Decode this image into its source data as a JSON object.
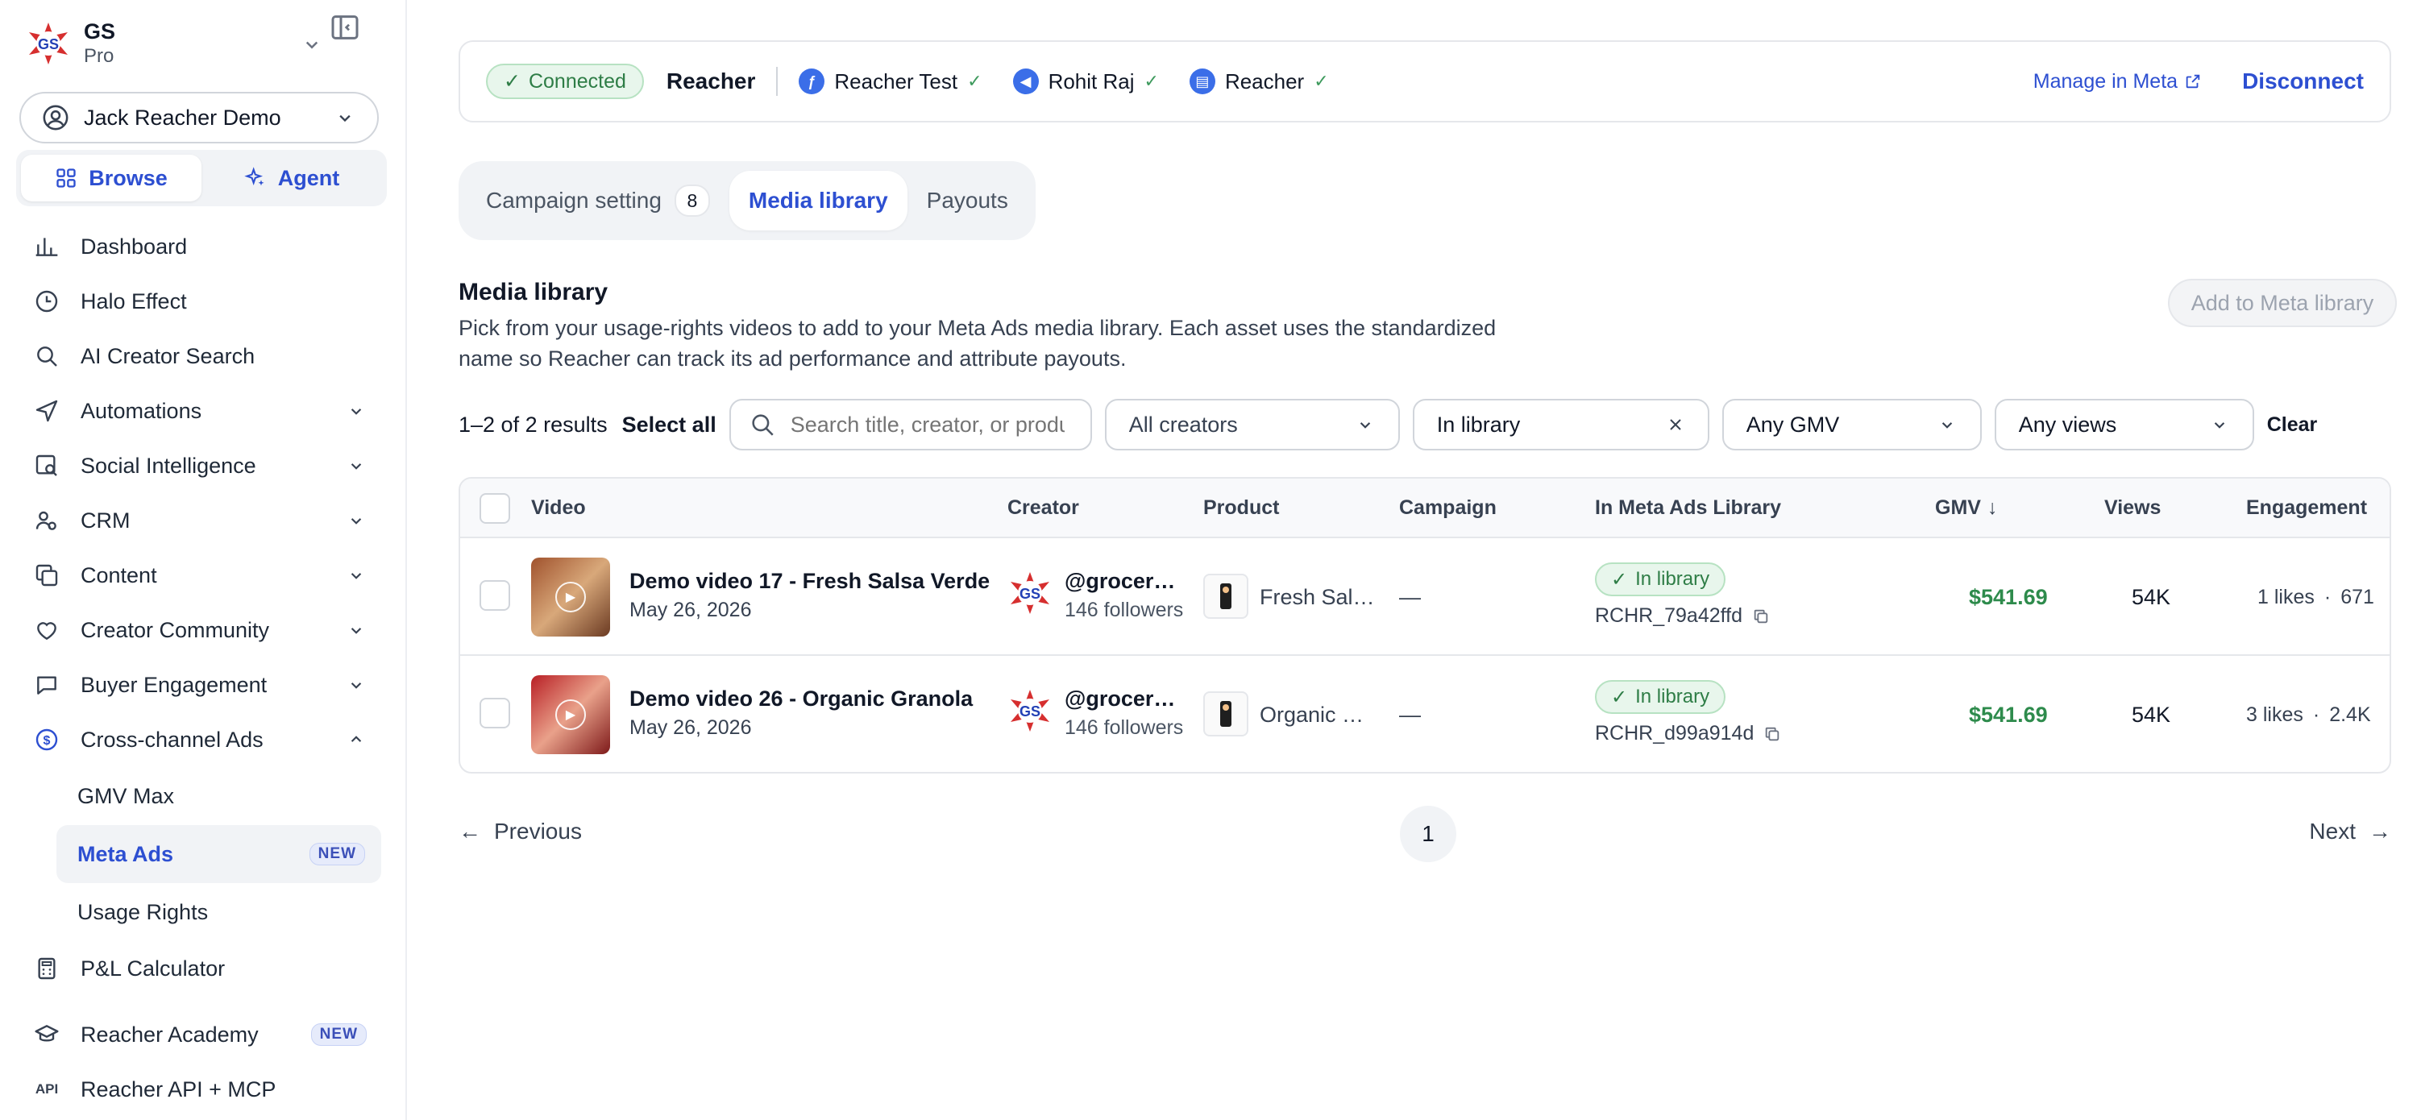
{
  "org": {
    "name": "GS",
    "plan": "Pro",
    "logo_text": "GS"
  },
  "account": {
    "label": "Jack Reacher Demo"
  },
  "mode": {
    "browse": "Browse",
    "agent": "Agent"
  },
  "nav": {
    "items": [
      {
        "label": "Dashboard",
        "icon": "chart-bar-icon"
      },
      {
        "label": "Halo Effect",
        "icon": "clock-icon"
      },
      {
        "label": "AI Creator Search",
        "icon": "search-icon"
      },
      {
        "label": "Automations",
        "icon": "send-icon"
      },
      {
        "label": "Social Intelligence",
        "icon": "image-search-icon"
      },
      {
        "label": "CRM",
        "icon": "people-icon"
      },
      {
        "label": "Content",
        "icon": "copy-icon"
      },
      {
        "label": "Creator Community",
        "icon": "heart-hands-icon"
      },
      {
        "label": "Buyer Engagement",
        "icon": "chat-icon"
      },
      {
        "label": "Cross-channel Ads",
        "icon": "dollar-circle-icon"
      }
    ],
    "sub_items": [
      {
        "label": "GMV Max"
      },
      {
        "label": "Meta Ads",
        "badge": "NEW"
      },
      {
        "label": "Usage Rights"
      }
    ],
    "bottom_items": [
      {
        "label": "P&L Calculator",
        "icon": "calculator-icon"
      },
      {
        "label": "Reacher Academy",
        "icon": "graduation-cap-icon",
        "badge": "NEW"
      },
      {
        "label": "Reacher API + MCP",
        "icon": "api-icon",
        "icon_text": "API"
      }
    ]
  },
  "connection": {
    "status": "Connected",
    "name": "Reacher",
    "accounts": [
      {
        "label": "Reacher Test",
        "icon": "meta-icon"
      },
      {
        "label": "Rohit Raj",
        "icon": "ads-icon"
      },
      {
        "label": "Reacher",
        "icon": "page-icon"
      }
    ],
    "manage_label": "Manage in Meta",
    "disconnect_label": "Disconnect"
  },
  "tabs": [
    {
      "label": "Campaign setting",
      "count": "8"
    },
    {
      "label": "Media library"
    },
    {
      "label": "Payouts"
    }
  ],
  "section": {
    "title": "Media library",
    "description": "Pick from your usage-rights videos to add to your Meta Ads media library. Each asset uses the standardized name so Reacher can track its ad performance and attribute payouts.",
    "add_button": "Add to Meta library"
  },
  "filters": {
    "results": "1–2 of 2 results",
    "select_all": "Select all",
    "search_placeholder": "Search title, creator, or product",
    "creators": "All creators",
    "library": "In library",
    "gmv": "Any GMV",
    "views": "Any views",
    "clear": "Clear"
  },
  "table": {
    "columns": [
      "Video",
      "Creator",
      "Product",
      "Campaign",
      "In Meta Ads Library",
      "GMV",
      "Views",
      "Engagement"
    ],
    "rows": [
      {
        "title": "Demo video 17 - Fresh Salsa Verde",
        "date": "May 26, 2026",
        "creator_handle": "@grocerystore",
        "creator_followers": "146 followers",
        "product": "Fresh Salsa Verde",
        "campaign": "—",
        "library_status": "In library",
        "library_code": "RCHR_79a42ffd",
        "gmv": "$541.69",
        "views": "54K",
        "likes": "1 likes",
        "engagement_sep": "·",
        "engagement_other": "671"
      },
      {
        "title": "Demo video 26 - Organic Granola",
        "date": "May 26, 2026",
        "creator_handle": "@grocerystore",
        "creator_followers": "146 followers",
        "product": "Organic Granola",
        "campaign": "—",
        "library_status": "In library",
        "library_code": "RCHR_d99a914d",
        "gmv": "$541.69",
        "views": "54K",
        "likes": "3 likes",
        "engagement_sep": "·",
        "engagement_other": "2.4K"
      }
    ]
  },
  "pagination": {
    "previous": "Previous",
    "page": "1",
    "next": "Next"
  },
  "colors": {
    "accent": "#2d4fd1",
    "success": "#2e8b4c",
    "brand_red": "#d62f2f",
    "brand_blue": "#2340b5"
  }
}
